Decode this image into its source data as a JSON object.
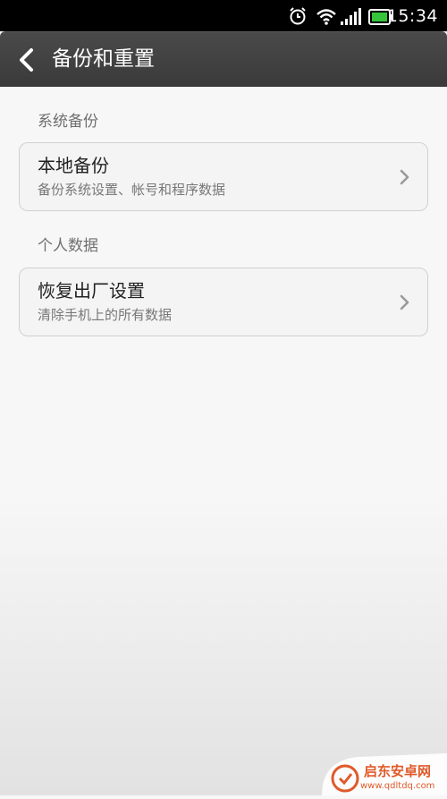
{
  "status_bar": {
    "time": "15:34",
    "icons": [
      "alarm-icon",
      "wifi-icon",
      "signal-icon",
      "battery-icon"
    ]
  },
  "header": {
    "title": "备份和重置",
    "back_icon": "back-arrow-icon"
  },
  "sections": [
    {
      "header": "系统备份",
      "item": {
        "title": "本地备份",
        "subtitle": "备份系统设置、帐号和程序数据"
      }
    },
    {
      "header": "个人数据",
      "item": {
        "title": "恢复出厂设置",
        "subtitle": "清除手机上的所有数据"
      }
    }
  ],
  "watermark": {
    "text": "启东安卓网",
    "url": "www.qdltdq.com"
  },
  "colors": {
    "status_bar": "#000000",
    "action_bar": "#424242",
    "background": "#f7f7f7",
    "battery": "#35c43a",
    "watermark": "#e05a2a"
  }
}
